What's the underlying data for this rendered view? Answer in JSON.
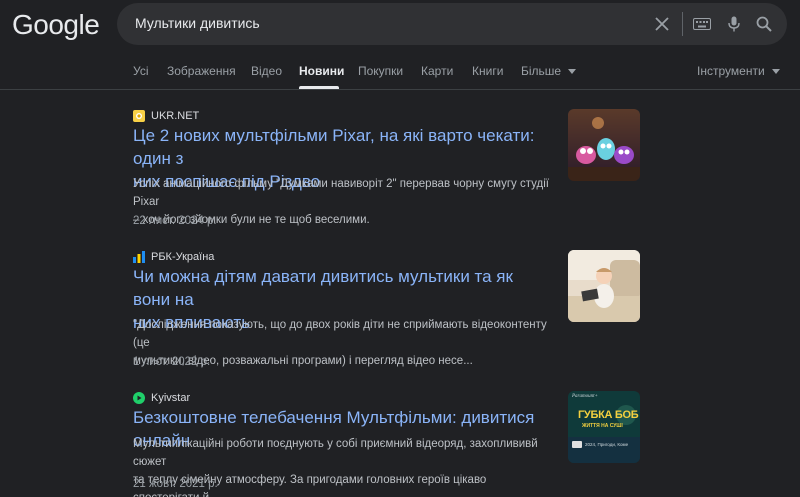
{
  "logo": "Google",
  "search": {
    "query": "Мультики дивитись"
  },
  "tabs": [
    {
      "label": "Усі",
      "active": false
    },
    {
      "label": "Зображення",
      "active": false
    },
    {
      "label": "Відео",
      "active": false
    },
    {
      "label": "Новини",
      "active": true
    },
    {
      "label": "Покупки",
      "active": false
    },
    {
      "label": "Карти",
      "active": false
    },
    {
      "label": "Книги",
      "active": false
    },
    {
      "label": "Більше",
      "active": false
    }
  ],
  "tools_label": "Інструменти",
  "icons": {
    "clear": "close-icon",
    "keyboard": "keyboard-icon",
    "voice": "microphone-icon",
    "search": "search-icon",
    "more_caret": "caret-down-icon"
  },
  "results": [
    {
      "source": "UKR.NET",
      "title_line1": "Це 2 нових мультфільми Pixar, на які варто чекати: один з",
      "title_line2": "них поспішає під Різдво",
      "snippet_line1": "Успіх анімаційного фільму \"Думками навиворіт 2\" перервав чорну смугу студії Pixar",
      "snippet_line2": "– хоч його зйомки були не те щоб веселими.",
      "date": "22 лист. 2024 р."
    },
    {
      "source": "РБК-Україна",
      "title_line1": "Чи можна дітям давати дивитись мультики та як вони на",
      "title_line2": "них впливають",
      "snippet_line1": "\"Дослідження показують, що до двох років діти не сприймають відеоконтенту (це",
      "snippet_line2": "мультики, відео, розважальні програми) і перегляд відео несе...",
      "date": "1 лист. 2022 р."
    },
    {
      "source": "Kyivstar",
      "title_line1": "Безкоштовне телебачення Мультфільми: дивитися онлайн",
      "snippet_line1": "Мультиплікаційні роботи поєднують у собі приємний відеоряд, захоплививй сюжет",
      "snippet_line2": "та теплу сімейну атмосферу. За пригодами головних героїв цікаво спостерігати й...",
      "date": "21 жовт. 2021 р.",
      "thumb_title": "ГУБКА БОБ",
      "thumb_subtitle": "ЖИТТЯ НА СУШІ",
      "thumb_meta": "2024, Пригоди, Коме",
      "thumb_badge": "Paramount+"
    }
  ],
  "colors": {
    "background": "#202124",
    "link": "#8ab4f8",
    "text": "#bdc1c6",
    "searchbar": "#303134"
  }
}
